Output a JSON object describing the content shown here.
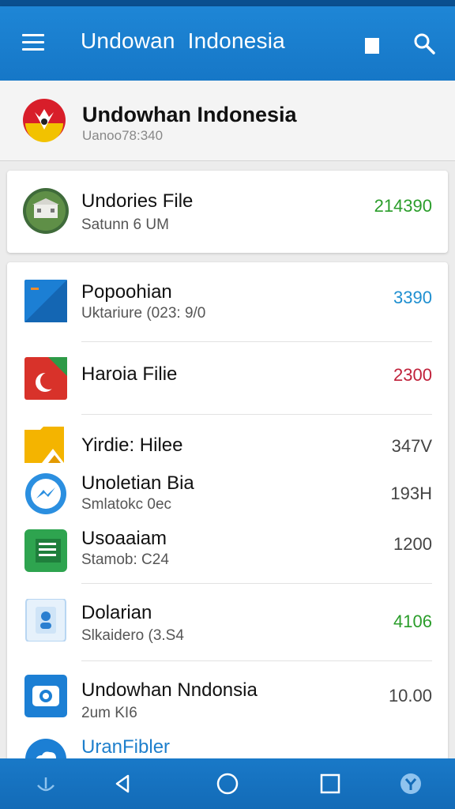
{
  "appbar": {
    "title": "Undowan  Indonesia"
  },
  "header": {
    "title": "Undowhan  Indonesia",
    "subtitle": "Uanoo78:340"
  },
  "featured": {
    "name": "Undories File",
    "sub": "Satunn 6 UM",
    "value": "214390",
    "value_color": "#2a9d2a"
  },
  "items": [
    {
      "name": "Popoohian",
      "sub": "Uktariure (023: 9/0",
      "value": "3390",
      "value_color": "#1e8fd0",
      "icon": "blue-square-icon"
    },
    {
      "name": "Haroia Filie",
      "sub": "",
      "value": "2300",
      "value_color": "#c0213a",
      "icon": "red-flag-icon"
    },
    {
      "name": "Yirdie: Hilee",
      "sub": "",
      "value": "347V",
      "value_color": "#444444",
      "icon": "yellow-folder-icon"
    },
    {
      "name": "Unoletian Bia",
      "sub": "Smlatokc 0ec",
      "value": "193H",
      "value_color": "#444444",
      "icon": "messenger-icon"
    },
    {
      "name": "Usoaaiam",
      "sub": "Stamob: C24",
      "value": "1200",
      "value_color": "#444444",
      "icon": "green-sheets-icon"
    },
    {
      "name": "Dolarian",
      "sub": "Slkaidero (3.S4",
      "value": "4106",
      "value_color": "#2a9d2a",
      "icon": "contact-card-icon"
    },
    {
      "name": "Undowhan Nndonsia",
      "sub": "2um KI6",
      "value": "10.00",
      "value_color": "#444444",
      "icon": "camera-icon"
    },
    {
      "name": "UranFibler",
      "sub": "",
      "value": "",
      "value_color": "#1e8fd0",
      "icon": "cloud-icon"
    }
  ],
  "navbar": {
    "items": [
      "download-icon",
      "back-icon",
      "home-icon",
      "recents-icon",
      "settings-icon"
    ]
  }
}
